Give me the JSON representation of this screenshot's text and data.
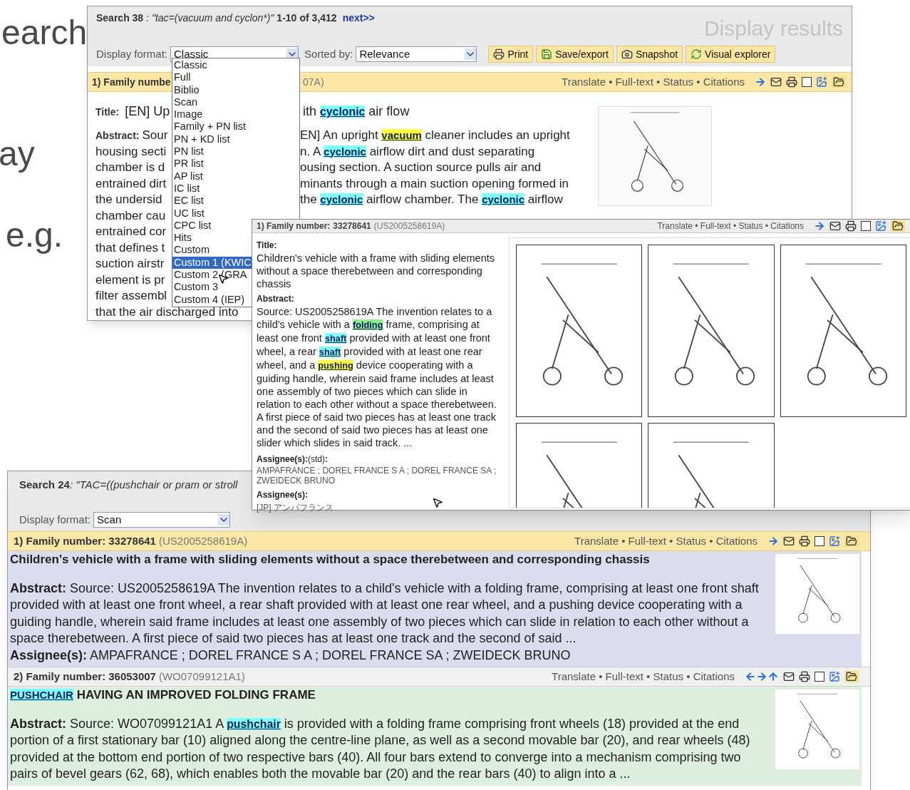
{
  "slide": {
    "texts": [
      "earch",
      "ay",
      "e.g."
    ]
  },
  "window_1": {
    "search": {
      "label": "Search 38",
      "query": ": \"tac=(vacuum and cyclon*)\" ",
      "range": "1-10",
      "of": "of",
      "total": "3,412",
      "next": "next>>"
    },
    "heading": "Display results",
    "display_format": {
      "label": "Display format:",
      "value": "Classic"
    },
    "sorted_by": {
      "label": "Sorted by:",
      "value": "Relevance"
    },
    "buttons": [
      {
        "label": "Print",
        "kind": "print"
      },
      {
        "label": "Save/export",
        "kind": "save"
      },
      {
        "label": "Snapshot",
        "kind": "snapshot"
      },
      {
        "label": "Visual explorer",
        "kind": "explorer"
      }
    ],
    "dropdown": {
      "options": [
        {
          "label": "Classic",
          "selected": false
        },
        {
          "label": "Full",
          "selected": false
        },
        {
          "label": "Biblio",
          "selected": false
        },
        {
          "label": "Scan",
          "selected": false
        },
        {
          "label": "Image",
          "selected": false
        },
        {
          "label": "Family + PN list",
          "selected": false
        },
        {
          "label": "PN + KD list",
          "selected": false
        },
        {
          "label": "PN list",
          "selected": false
        },
        {
          "label": "PR list",
          "selected": false
        },
        {
          "label": "AP list",
          "selected": false
        },
        {
          "label": "IC list",
          "selected": false
        },
        {
          "label": "EC list",
          "selected": false
        },
        {
          "label": "UC list",
          "selected": false
        },
        {
          "label": "CPC list",
          "selected": false
        },
        {
          "label": "Hits",
          "selected": false
        },
        {
          "label": "Custom",
          "selected": false
        },
        {
          "label": "Custom 1 (KWIC",
          "selected": true
        },
        {
          "label": "Custom 2 (GRA",
          "selected": false
        },
        {
          "label": "Custom 3",
          "selected": false
        },
        {
          "label": "Custom 4 (IEP)",
          "selected": false
        }
      ]
    },
    "result": {
      "header_left": "1) Family numbe",
      "header_right": "07A)",
      "links": "Translate • Full-text • Status • Citations",
      "arrows": [
        {
          "kind": "right"
        }
      ],
      "checked": false,
      "title_label": "Title:",
      "title_left": "[EN] Up",
      "title_right": [
        {
          "text": "ith "
        },
        {
          "text": "cyclonic",
          "color": "#80ffff"
        },
        {
          "text": " air flow"
        }
      ],
      "abstract_label": "Abstract:",
      "lines": [
        {
          "left": "Sour",
          "right": [
            {
              "text": "EN] An upright "
            },
            {
              "text": "vacuum",
              "color": "#ffff40"
            },
            {
              "text": " cleaner includes an upright"
            }
          ]
        },
        {
          "left": "housing secti",
          "right": [
            {
              "text": "n. A "
            },
            {
              "text": "cyclonic",
              "color": "#80ffff"
            },
            {
              "text": " airflow dirt and dust separating"
            }
          ]
        },
        {
          "left": "chamber is d",
          "right": [
            {
              "text": "ousing section. A suction source pulls air and"
            }
          ]
        },
        {
          "left": "entrained dirt",
          "right": [
            {
              "text": "minants through a main suction opening formed in"
            }
          ]
        },
        {
          "left": "the undersid",
          "right": [
            {
              "text": "the "
            },
            {
              "text": "cyclonic",
              "color": "#80ffff"
            },
            {
              "text": " airflow chamber. The "
            },
            {
              "text": "cyclonic",
              "color": "#80ffff"
            },
            {
              "text": " airflow"
            }
          ]
        },
        {
          "left": "chamber cau"
        },
        {
          "left": "entrained cor"
        },
        {
          "left": "that defines t"
        },
        {
          "left": "suction airstr"
        },
        {
          "left": "element is pr"
        },
        {
          "left": "filter assembl"
        },
        {
          "left": "that the air discharged into"
        }
      ]
    }
  },
  "window_2": {
    "header": {
      "label": "1) Family number:",
      "number": "33278641",
      "pub": "(US2005258619A)"
    },
    "links": "Translate • Full-text • Status • Citations",
    "arrows": [
      {
        "kind": "right"
      }
    ],
    "checked": false,
    "title_label": "Title:",
    "title": "Children's vehicle with a frame with sliding elements without a space therebetween and corresponding chassis",
    "abstract_label": "Abstract:",
    "abstract": [
      {
        "text": "Source: US2005258619A  The invention relates to a child's vehicle with a "
      },
      {
        "text": "folding",
        "color": "#90ee90"
      },
      {
        "text": " frame, comprising at least one front "
      },
      {
        "text": "shaft",
        "color": "#80ffff"
      },
      {
        "text": " provided with at least one front wheel, a rear "
      },
      {
        "text": "shaft",
        "color": "#80ffff"
      },
      {
        "text": " provided with at least one rear wheel, and a "
      },
      {
        "text": "pushing",
        "color": "#ffff40"
      },
      {
        "text": " device cooperating with a guiding handle, wherein said frame includes at least one assembly of two pieces which can slide in relation to each other without a space therebetween. A first piece of said two pieces has at least one track and the second of said two pieces has at least one slider which slides in said track. ..."
      }
    ],
    "assignee_std_label": "**Assignee(s):**(std)**:**",
    "assignees_std": "AMPAFRANCE ; DOREL FRANCE S A ; DOREL FRANCE SA ; ZWEIDECK BRUNO",
    "assignee_label": "Assignee(s):",
    "assignee_jp": "[JP] アンパフランス"
  },
  "window_3": {
    "search": {
      "label": "Search 24",
      "query": ": \"TAC=((pushchair or pram or stroll"
    },
    "display_format": {
      "label": "Display format:",
      "value": "Scan"
    },
    "results": [
      {
        "selected": true,
        "color": "#dcdcef",
        "header": {
          "label": "1) Family number:",
          "number": "33278641",
          "pub": "(US2005258619A)"
        },
        "links": "Translate • Full-text • Status • Citations",
        "arrows": [
          {
            "kind": "right"
          }
        ],
        "checked": false,
        "title": [
          {
            "text": "Children's vehicle with a frame with sliding elements without a space therebetween and corresponding chassis"
          }
        ],
        "abstract_label": "Abstract:",
        "abstract": [
          {
            "text": "Source: US2005258619A The invention relates to a child's vehicle with a folding frame, comprising at least one front shaft provided with at least one front wheel, a rear shaft provided with at least one rear wheel, and a pushing device cooperating with a guiding handle, wherein said frame includes at least one assembly of two pieces which can slide in relation to each other without a space therebetween. A first piece of said two pieces has at least one track and the second of said ..."
          }
        ],
        "assignee_label": "Assignee(s):",
        "assignees": "AMPAFRANCE ; DOREL FRANCE S A ; DOREL FRANCE SA ; ZWEIDECK BRUNO"
      },
      {
        "selected": false,
        "color": "#dfefdf",
        "header": {
          "label": "2) Family number:",
          "number": "36053007",
          "pub": "(WO07099121A1)"
        },
        "links": "Translate • Full-text • Status • Citations",
        "arrows": [
          {
            "kind": "left"
          },
          {
            "kind": "right"
          },
          {
            "kind": "up"
          }
        ],
        "checked": false,
        "title": [
          {
            "text": "PUSHCHAIR",
            "color": "#80ffff"
          },
          {
            "text": " HAVING AN IMPROVED FOLDING FRAME"
          }
        ],
        "abstract_label": "Abstract:",
        "abstract": [
          {
            "text": "Source: WO07099121A1  A "
          },
          {
            "text": "pushchair",
            "color": "#80ffff"
          },
          {
            "text": " is provided with a folding frame comprising front wheels (18) provided at the end portion of a first stationary bar (10) aligned along the centre-line plane, as well as a second movable bar (20), and rear wheels (48) provided at the bottom end portion of two respective bars (40). All four bars extend to converge into a mechanism comprising two pairs of bevel gears (62, 68), which enables both the movable bar (20) and the rear bars (40) to align into a ..."
          }
        ]
      }
    ]
  }
}
